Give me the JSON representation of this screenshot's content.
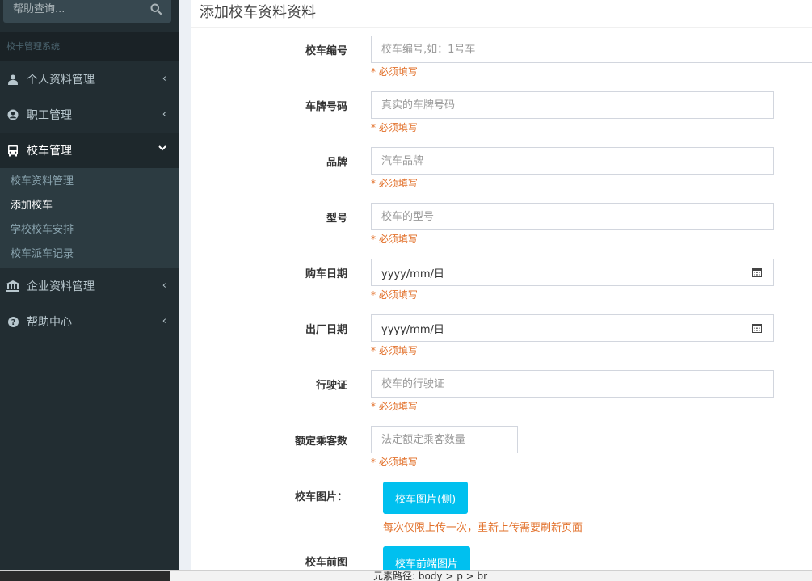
{
  "sidebar": {
    "search_placeholder": "帮助查询...",
    "system_header": "校卡管理系统",
    "menu": [
      {
        "label": "个人资料管理",
        "icon": "user-icon",
        "arrow": "‹"
      },
      {
        "label": "职工管理",
        "icon": "user-circle-icon",
        "arrow": "‹"
      },
      {
        "label": "校车管理",
        "icon": "bus-icon",
        "arrow": "⌄"
      },
      {
        "label": "企业资料管理",
        "icon": "bank-icon",
        "arrow": "‹"
      },
      {
        "label": "帮助中心",
        "icon": "question-circle-icon",
        "arrow": "‹"
      }
    ],
    "submenu": [
      "校车资料管理",
      "添加校车",
      "学校校车安排",
      "校车派车记录"
    ]
  },
  "form": {
    "title": "添加校车资料资料",
    "required_text": "* 必须填写",
    "fields": [
      {
        "label": "校车编号",
        "placeholder": "校车编号,如：1号车"
      },
      {
        "label": "车牌号码",
        "placeholder": "真实的车牌号码"
      },
      {
        "label": "品牌",
        "placeholder": "汽车品牌"
      },
      {
        "label": "型号",
        "placeholder": "校车的型号"
      },
      {
        "label": "购车日期",
        "value": "yyyy/mm/日"
      },
      {
        "label": "出厂日期",
        "value": "yyyy/mm/日"
      },
      {
        "label": "行驶证",
        "placeholder": "校车的行驶证"
      },
      {
        "label": "额定乘客数",
        "placeholder": "法定额定乘客数量"
      }
    ],
    "upload_side_label": "校车图片：",
    "upload_side_button": "校车图片(侧)",
    "upload_note": "每次仅限上传一次，重新上传需要刷新页面",
    "upload_front_label": "校车前图",
    "upload_front_button": "校车前端图片"
  },
  "statusbar": {
    "path": "元素路径: body > p > br"
  },
  "colors": {
    "sidebar_bg": "#222d32",
    "accent": "#00c0ef",
    "required": "#e2702a"
  }
}
